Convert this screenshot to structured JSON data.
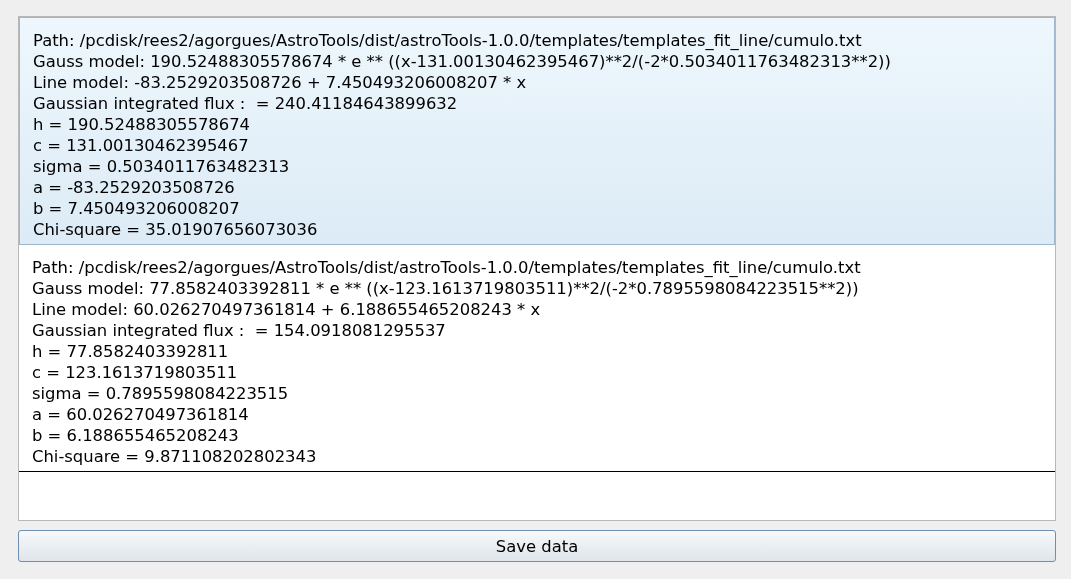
{
  "results": [
    {
      "selected": true,
      "lines": [
        "Path: /pcdisk/rees2/agorgues/AstroTools/dist/astroTools-1.0.0/templates/templates_fit_line/cumulo.txt",
        "Gauss model: 190.52488305578674 * e ** ((x-131.00130462395467)**2/(-2*0.5034011763482313**2))",
        "Line model: -83.2529203508726 + 7.450493206008207 * x",
        "Gaussian integrated flux :  = 240.41184643899632",
        "h = 190.52488305578674",
        "c = 131.00130462395467",
        "sigma = 0.5034011763482313",
        "a = -83.2529203508726",
        "b = 7.450493206008207",
        "Chi-square = 35.01907656073036"
      ]
    },
    {
      "selected": false,
      "lines": [
        "Path: /pcdisk/rees2/agorgues/AstroTools/dist/astroTools-1.0.0/templates/templates_fit_line/cumulo.txt",
        "Gauss model: 77.8582403392811 * e ** ((x-123.1613719803511)**2/(-2*0.7895598084223515**2))",
        "Line model: 60.026270497361814 + 6.188655465208243 * x",
        "Gaussian integrated flux :  = 154.0918081295537",
        "h = 77.8582403392811",
        "c = 123.1613719803511",
        "sigma = 0.7895598084223515",
        "a = 60.026270497361814",
        "b = 6.188655465208243",
        "Chi-square = 9.871108202802343"
      ]
    }
  ],
  "save_button": "Save data"
}
